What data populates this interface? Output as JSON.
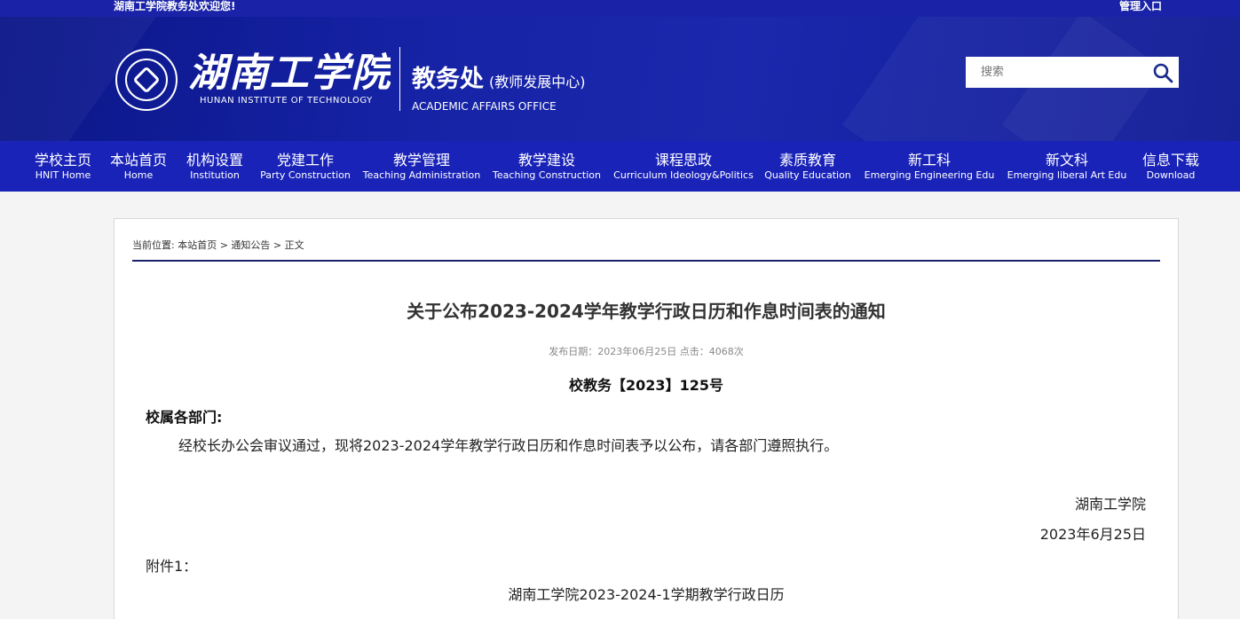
{
  "topbar": {
    "welcome": "湖南工学院教务处欢迎您!",
    "admin_link": "管理入口"
  },
  "header": {
    "school_name_cn": "湖南工学院",
    "school_name_en": "HUNAN INSTITUTE OF TECHNOLOGY",
    "office_name_cn": "教务处",
    "office_sub_cn": "(教师发展中心)",
    "office_name_en": "ACADEMIC AFFAIRS OFFICE"
  },
  "search": {
    "placeholder": "搜索",
    "icon": "search-icon"
  },
  "nav": {
    "items": [
      {
        "cn": "学校主页",
        "en": "HNIT Home"
      },
      {
        "cn": "本站首页",
        "en": "Home"
      },
      {
        "cn": "机构设置",
        "en": "Institution"
      },
      {
        "cn": "党建工作",
        "en": "Party Construction"
      },
      {
        "cn": "教学管理",
        "en": "Teaching Administration"
      },
      {
        "cn": "教学建设",
        "en": "Teaching Construction"
      },
      {
        "cn": "课程思政",
        "en": "Curriculum Ideology&Politics"
      },
      {
        "cn": "素质教育",
        "en": "Quality Education"
      },
      {
        "cn": "新工科",
        "en": "Emerging Engineering Edu"
      },
      {
        "cn": "新文科",
        "en": "Emerging liberal Art Edu"
      },
      {
        "cn": "信息下载",
        "en": "Download"
      }
    ]
  },
  "breadcrumb": {
    "prefix": "当前位置: ",
    "home": "本站首页",
    "sep": " > ",
    "section": "通知公告",
    "current": "正文"
  },
  "article": {
    "title": "关于公布2023-2024学年教学行政日历和作息时间表的通知",
    "meta": "发布日期：2023年06月25日 点击：4068次",
    "doc_number": "校教务【2023】125号",
    "salutation": "校属各部门:",
    "body": "经校长办公会审议通过，现将2023-2024学年教学行政日历和作息时间表予以公布，请各部门遵照执行。",
    "signature_org": "湖南工学院",
    "signature_date": "2023年6月25日",
    "attachment_label": "附件1：",
    "attachment_title": "湖南工学院2023-2024-1学期教学行政日历"
  },
  "colors": {
    "topbar": "#1a23a8",
    "nav": "#1a23b8",
    "header_dark": "#0b1688",
    "crumb_line": "#1b2069"
  }
}
